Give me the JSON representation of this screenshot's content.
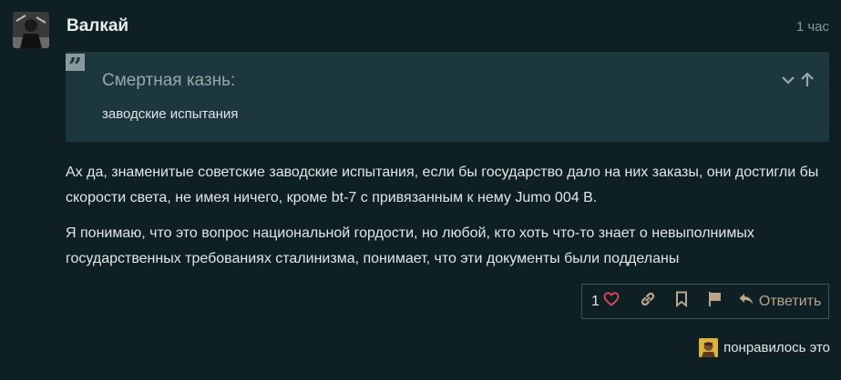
{
  "post": {
    "username": "Валкай",
    "time": "1 час",
    "quote": {
      "author": "Смертная казнь:",
      "text": "заводские испытания"
    },
    "paragraphs": [
      "Ах да, знаменитые советские заводские испытания, если бы государство дало на них заказы, они достигли бы скорости света, не имея ничего, кроме bt-7 с привязанным к нему Jumo 004 B.",
      "Я понимаю, что это вопрос национальной гордости, но любой, кто хоть что-то знает о невыполнимых государственных требованиях сталинизма, понимает, что эти документы были подделаны"
    ],
    "actions": {
      "like_count": "1",
      "reply_label": "Ответить"
    },
    "liked_by_label": "понравилось это"
  },
  "colors": {
    "background": "#0f2025",
    "quote_bg": "#1c373d",
    "accent": "#b9a58d",
    "heart": "#e0475b"
  },
  "icons": [
    "quote-icon",
    "chevron-down-icon",
    "arrow-up-icon",
    "heart-icon",
    "link-icon",
    "bookmark-icon",
    "flag-icon",
    "reply-icon"
  ]
}
